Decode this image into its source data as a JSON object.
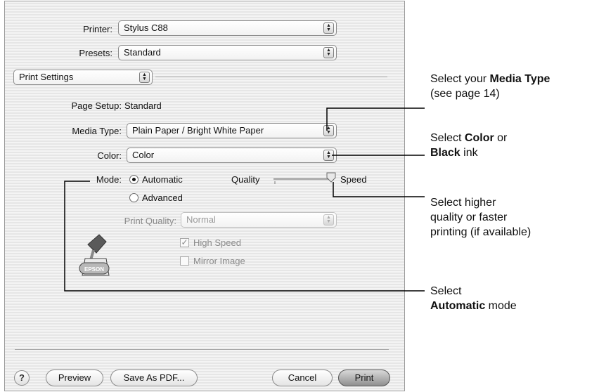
{
  "printer": {
    "label": "Printer:",
    "value": "Stylus C88"
  },
  "presets": {
    "label": "Presets:",
    "value": "Standard"
  },
  "panel": {
    "value": "Print Settings"
  },
  "page_setup": {
    "label": "Page Setup:",
    "value": "Standard"
  },
  "media_type": {
    "label": "Media Type:",
    "value": "Plain Paper / Bright White Paper"
  },
  "color": {
    "label": "Color:",
    "value": "Color"
  },
  "mode": {
    "label": "Mode:",
    "automatic": "Automatic",
    "advanced": "Advanced",
    "selected": "Automatic",
    "quality_label": "Quality",
    "speed_label": "Speed",
    "slider_value_fraction": 1.0
  },
  "print_quality": {
    "label": "Print Quality:",
    "value": "Normal"
  },
  "high_speed": {
    "label": "High Speed",
    "checked": true
  },
  "mirror_image": {
    "label": "Mirror Image",
    "checked": false
  },
  "buttons": {
    "help": "?",
    "preview": "Preview",
    "save_pdf": "Save As PDF...",
    "cancel": "Cancel",
    "print": "Print"
  },
  "callouts": {
    "media": {
      "pre": "Select your ",
      "bold": "Media Type",
      "line2": "(see page 14)"
    },
    "color": {
      "pre": "Select ",
      "bold": "Color",
      "post": " or",
      "bold2": "Black",
      "post2": " ink"
    },
    "quality": {
      "line1": "Select higher",
      "line2": "quality or faster",
      "line3": "printing (if available)"
    },
    "mode": {
      "line1": "Select",
      "bold": "Automatic",
      "post": " mode"
    }
  },
  "icons": {
    "logo": "epson-ink-logo-icon",
    "epson_text": "EPSON"
  },
  "colors": {
    "callout_line": "#000000",
    "panel_bg": "#ececec"
  }
}
